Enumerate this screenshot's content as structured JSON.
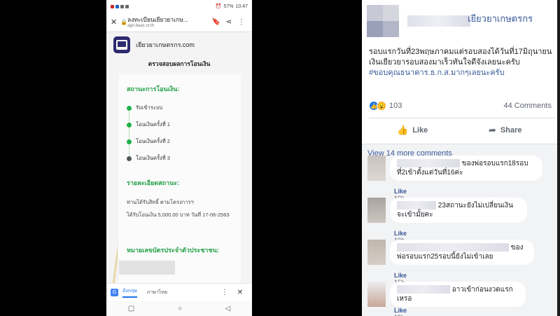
{
  "phone": {
    "status": {
      "battery": "57%",
      "time": "10:47"
    },
    "browser": {
      "page_title": "ลงทะเบียนเยียวยาเกษ...",
      "domain": "agri.baac.or.th"
    },
    "brand": "เยียวยาเกษตรกร.com",
    "page_heading": "ตรวจสอบผลการโอนเงิน",
    "transfer_status_title": "สถานะการโอนเงิน:",
    "steps": [
      {
        "label": "รับเข้าระบบ",
        "done": true
      },
      {
        "label": "โอนเงินครั้งที่ 1",
        "done": true
      },
      {
        "label": "โอนเงินครั้งที่ 2",
        "done": true
      },
      {
        "label": "โอนเงินครั้งที่ 3",
        "done": false
      }
    ],
    "detail_title": "รายละเอียดสถานะ:",
    "detail_line1": "ท่านได้รับสิทธิ์ ตามโครงการฯ",
    "detail_line2": "ได้รับโอนเงิน 5,000.00 บาท วันที่ 17-06-2563",
    "id_title": "หมายเลขบัตรประจำตัวประชาชน:",
    "translate": {
      "active_lang": "อังกฤษ",
      "other_lang": "ภาษาไทย"
    }
  },
  "post": {
    "page_name": "เยียวยาเกษตรกร",
    "text": "รอบแรกวันที่23พฤษภาคมแต่รอบสองได้วันที่17มิถุนายนเงินเยียวยารอบสองมาเร็วทันใจดีจังเลยนะครับ",
    "hashtag": "#ขอบคุณธนาคาร.ธ.ก.ส.มากๆเลยนะครับ",
    "reactions_count": "103",
    "comments_count": "44 Comments",
    "like_label": "Like",
    "share_label": "Share",
    "view_more": "View 14 more comments",
    "comments": [
      {
        "text": "ของพ่อรอบแรก18รอบที่2เข้าตั้งแต่วันที่16ค่ะ",
        "like": "Like",
        "time": "19h"
      },
      {
        "text": "23สถานะยังไม่เปลี่ยนเงินจะเข้ามั้ยคะ",
        "like": "Like",
        "time": "19h"
      },
      {
        "text": "ของพ่อรอบแรก25รอบนี้ยังไม่เข้าเลย",
        "like": "Like",
        "time": "15h"
      },
      {
        "text": "อาวเข้าก่อนงวดแรกเหรอ",
        "like": "Like",
        "time": "15h"
      }
    ]
  },
  "colors": {
    "fb_link": "#385898",
    "status_green": "#24a148",
    "fb_blue": "#1877f2"
  }
}
